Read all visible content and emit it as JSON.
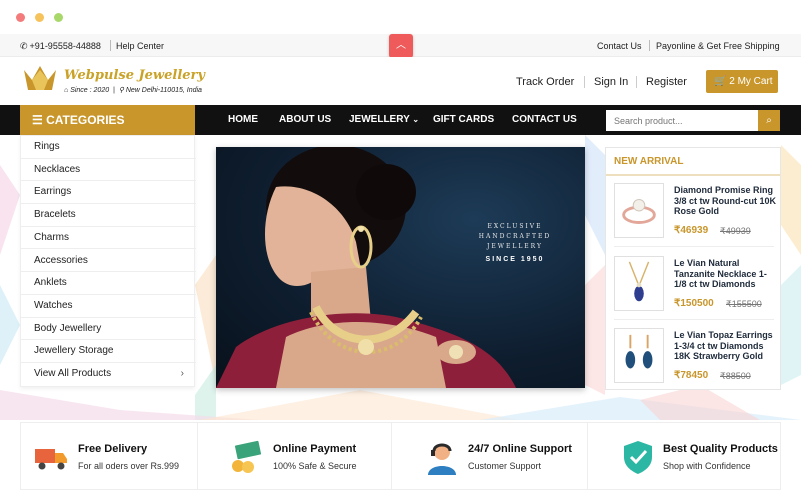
{
  "topbar": {
    "phone": "+91-95558-44888",
    "help": "Help Center",
    "contact": "Contact Us",
    "payonline": "Payonline & Get Free Shipping"
  },
  "header": {
    "brand": "Webpulse Jewellery",
    "since": "Since : 2020",
    "location": "New Delhi-110015, India",
    "track": "Track Order",
    "signin": "Sign In",
    "register": "Register",
    "cart": "2 My Cart"
  },
  "nav": {
    "categories": "CATEGORIES",
    "items": [
      "HOME",
      "ABOUT US",
      "JEWELLERY",
      "GIFT CARDS",
      "CONTACT US"
    ],
    "search_placeholder": "Search product..."
  },
  "categories": [
    "Rings",
    "Necklaces",
    "Earrings",
    "Bracelets",
    "Charms",
    "Accessories",
    "Anklets",
    "Watches",
    "Body Jewellery",
    "Jewellery Storage",
    "View All Products"
  ],
  "banner": {
    "line1": "EXCLUSIVE",
    "line2": "HANDCRAFTED",
    "line3": "JEWELLERY",
    "since": "SINCE 1950"
  },
  "arrival": {
    "title": "NEW ARRIVAL",
    "products": [
      {
        "name": "Diamond Promise Ring 3/8 ct tw Round-cut 10K Rose Gold",
        "price": "₹46939",
        "old": "₹49939"
      },
      {
        "name": "Le Vian Natural Tanzanite Necklace 1-1/8 ct tw Diamonds",
        "price": "₹150500",
        "old": "₹155500"
      },
      {
        "name": "Le Vian Topaz Earrings 1-3/4 ct tw Diamonds 18K Strawberry Gold",
        "price": "₹78450",
        "old": "₹88500"
      }
    ]
  },
  "features": [
    {
      "title": "Free Delivery",
      "sub": "For all oders over Rs.999",
      "icon": "truck-icon"
    },
    {
      "title": "Online Payment",
      "sub": "100% Safe & Secure",
      "icon": "money-icon"
    },
    {
      "title": "24/7 Online Support",
      "sub": "Customer Support",
      "icon": "support-agent-icon"
    },
    {
      "title": "Best Quality Products",
      "sub": "Shop with Confidence",
      "icon": "shield-check-icon"
    }
  ],
  "colors": {
    "gold": "#c8962b",
    "dark": "#111111",
    "accent_red": "#ef5b5b"
  }
}
